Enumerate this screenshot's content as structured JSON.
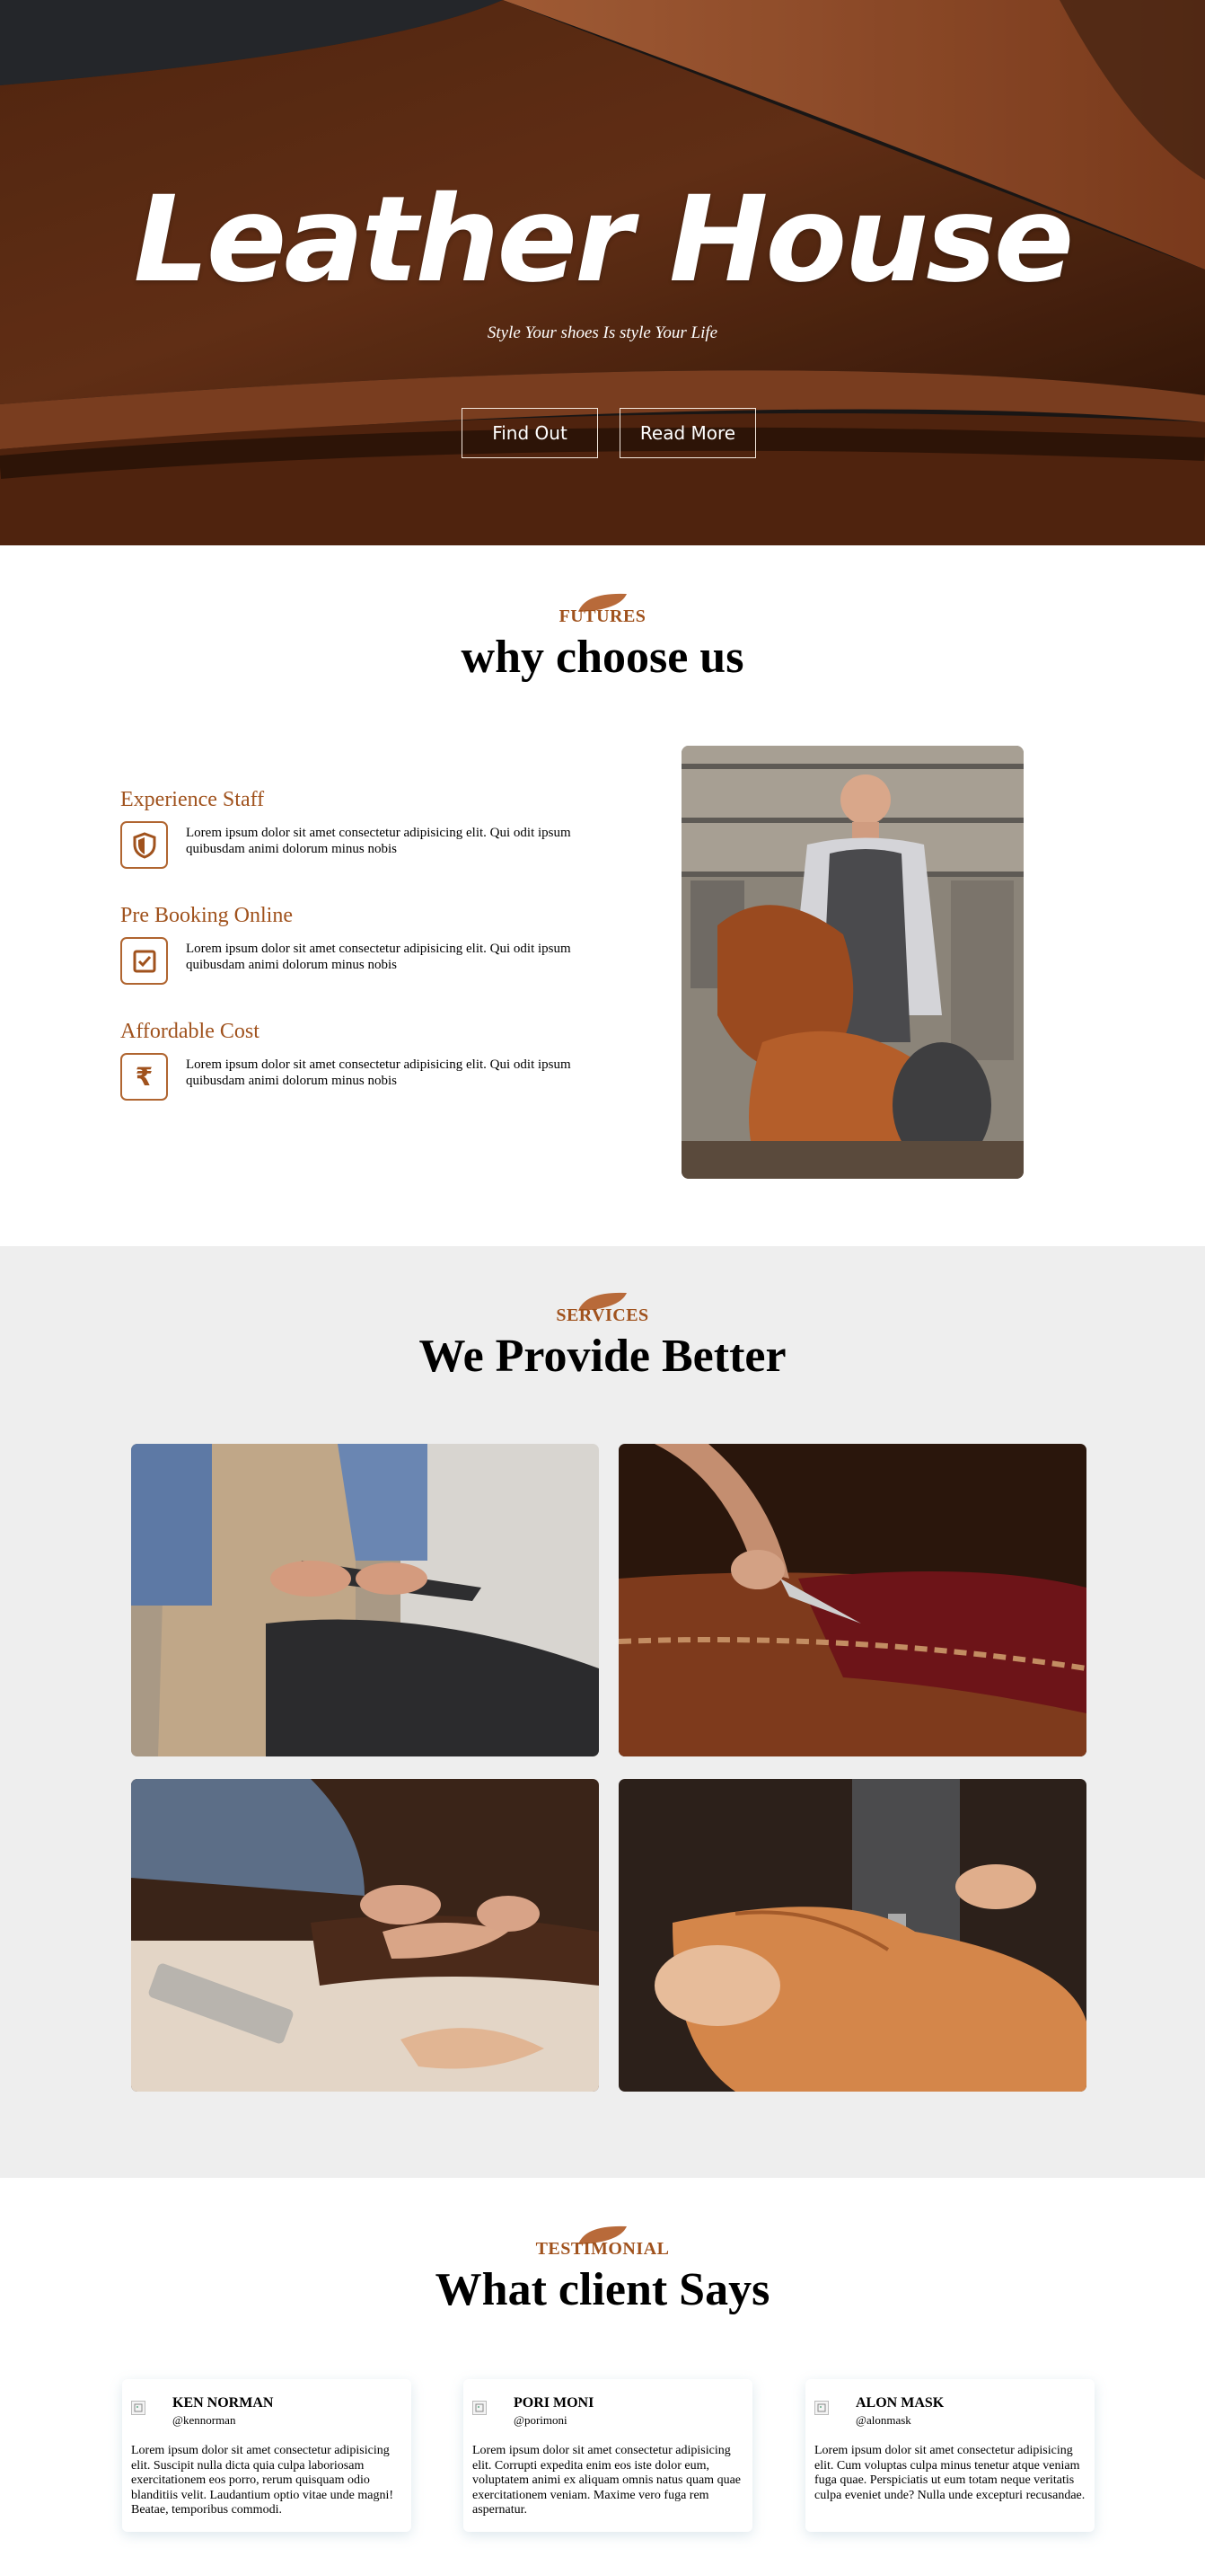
{
  "hero": {
    "title": "Leather House",
    "subtitle": "Style Your shoes Is style Your Life",
    "find_out_label": "Find Out",
    "read_more_label": "Read More"
  },
  "why": {
    "kicker": "FUTURES",
    "title": "why choose us",
    "features": [
      {
        "title": "Experience Staff",
        "text": "Lorem ipsum dolor sit amet consectetur adipisicing elit. Qui odit ipsum quibusdam animi dolorum minus nobis",
        "icon": "shield-icon"
      },
      {
        "title": "Pre Booking Online",
        "text": "Lorem ipsum dolor sit amet consectetur adipisicing elit. Qui odit ipsum quibusdam animi dolorum minus nobis",
        "icon": "checkbox-icon"
      },
      {
        "title": "Affordable Cost",
        "text": "Lorem ipsum dolor sit amet consectetur adipisicing elit. Qui odit ipsum quibusdam animi dolorum minus nobis",
        "icon": "rupee-icon"
      }
    ]
  },
  "services": {
    "kicker": "SERVICES",
    "title": "We Provide Better"
  },
  "testimonial": {
    "kicker": "TESTIMONIAL",
    "title": "What client Says",
    "cards": [
      {
        "name": "KEN NORMAN",
        "handle": "@kennorman",
        "text": "Lorem ipsum dolor sit amet consectetur adipisicing elit. Suscipit nulla dicta quia culpa laboriosam exercitationem eos porro, rerum quisquam odio blanditiis velit. Laudantium optio vitae unde magni! Beatae, temporibus commodi."
      },
      {
        "name": "PORI MONI",
        "handle": "@porimoni",
        "text": "Lorem ipsum dolor sit amet consectetur adipisicing elit. Corrupti expedita enim eos iste dolor eum, voluptatem animi ex aliquam omnis natus quam quae exercitationem veniam. Maxime vero fuga rem aspernatur."
      },
      {
        "name": "ALON MASK",
        "handle": "@alonmask",
        "text": "Lorem ipsum dolor sit amet consectetur adipisicing elit. Cum voluptas culpa minus tenetur atque veniam fuga quae. Perspiciatis ut eum totam neque veritatis culpa eveniet unde? Nulla unde excepturi recusandae."
      }
    ]
  },
  "colors": {
    "accent": "#a0521d",
    "services_bg": "#eeeeee"
  }
}
